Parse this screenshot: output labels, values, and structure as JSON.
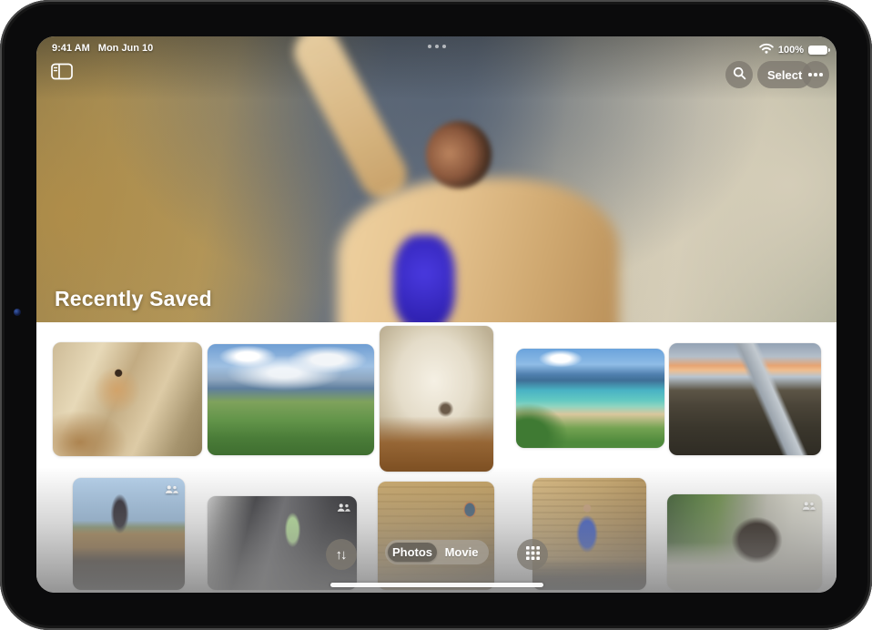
{
  "status_bar": {
    "time": "9:41 AM",
    "date": "Mon Jun 10",
    "battery_percent": "100%",
    "icons": {
      "wifi": "wifi-icon",
      "battery": "battery-full-icon",
      "multitasking": "three-dots-handle"
    }
  },
  "toolbar": {
    "sidebar_icon": "sidebar-toggle",
    "search_icon": "magnifying-glass",
    "select_label": "Select",
    "more_icon": "ellipsis-circle"
  },
  "hero": {
    "title": "Recently Saved"
  },
  "grid": {
    "people_badge_icon": "two-people",
    "photos": [
      {
        "description": "person in tan suit jumping by rock formation",
        "people_badge": false
      },
      {
        "description": "green alpine valley with mountains and clouds",
        "people_badge": false
      },
      {
        "description": "shaggy white dog lying on wood floor",
        "people_badge": false
      },
      {
        "description": "tropical bay with beach and green hillside",
        "people_badge": false
      },
      {
        "description": "road through dark lava field at dusk",
        "people_badge": false
      },
      {
        "description": "person kicking leg up by brick wall and sky",
        "people_badge": true
      },
      {
        "description": "person in green outfit crossing dark plaza",
        "people_badge": true
      },
      {
        "description": "brick building facade with arched window",
        "people_badge": false
      },
      {
        "description": "person in blue jacket against brick wall",
        "people_badge": false
      },
      {
        "description": "back of person's head with trees and wall",
        "people_badge": true
      }
    ]
  },
  "controls": {
    "sort_glyph": "↑↓",
    "sort_icon": "arrows-up-down",
    "view_options": [
      {
        "label": "Photos",
        "selected": true
      },
      {
        "label": "Movie",
        "selected": false
      }
    ],
    "grid_icon": "thumbnail-grid",
    "home_indicator": "home-indicator-bar"
  },
  "colors": {
    "chrome_button": "rgba(125,121,112,0.78)",
    "segment_container": "rgba(168,162,152,0.72)",
    "segment_selected": "rgba(103,98,90,0.95)",
    "text_on_chrome": "#ffffff",
    "canvas": "#ffffff",
    "bezel": "#0b0b0c"
  }
}
